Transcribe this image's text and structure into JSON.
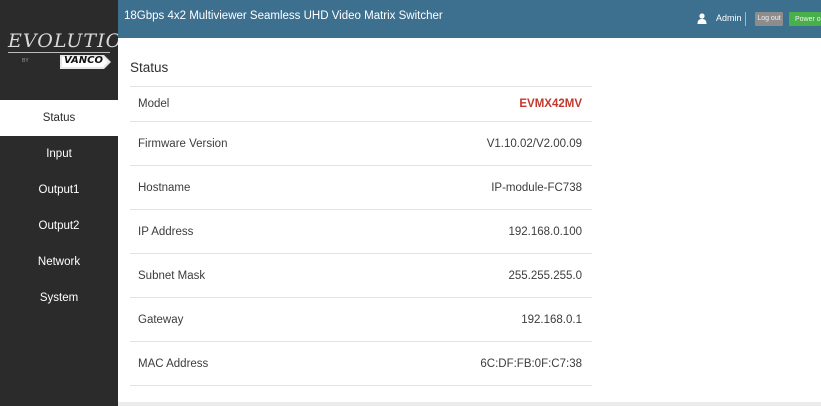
{
  "logo": {
    "brand": "EVOLUTION",
    "by": "BY",
    "sub": "VANCO"
  },
  "header": {
    "title": "18Gbps 4x2 Multiviewer Seamless UHD Video Matrix Switcher",
    "user": "Admin",
    "logout_label": "Log out",
    "power_label": "Power on"
  },
  "sidebar": {
    "items": [
      {
        "label": "Status"
      },
      {
        "label": "Input"
      },
      {
        "label": "Output1"
      },
      {
        "label": "Output2"
      },
      {
        "label": "Network"
      },
      {
        "label": "System"
      }
    ]
  },
  "main": {
    "title": "Status",
    "rows": [
      {
        "label": "Model",
        "value": "EVMX42MV"
      },
      {
        "label": "Firmware Version",
        "value": "V1.10.02/V2.00.09"
      },
      {
        "label": "Hostname",
        "value": "IP-module-FC738"
      },
      {
        "label": "IP Address",
        "value": "192.168.0.100"
      },
      {
        "label": "Subnet Mask",
        "value": "255.255.255.0"
      },
      {
        "label": "Gateway",
        "value": "192.168.0.1"
      },
      {
        "label": "MAC Address",
        "value": "6C:DF:FB:0F:C7:38"
      }
    ]
  },
  "colors": {
    "topbar": "#3d6f8f",
    "sidebar": "#2b2b2b",
    "model_value": "#c2382d",
    "power_button": "#48b04a",
    "logout_button": "#8d8d8d"
  }
}
